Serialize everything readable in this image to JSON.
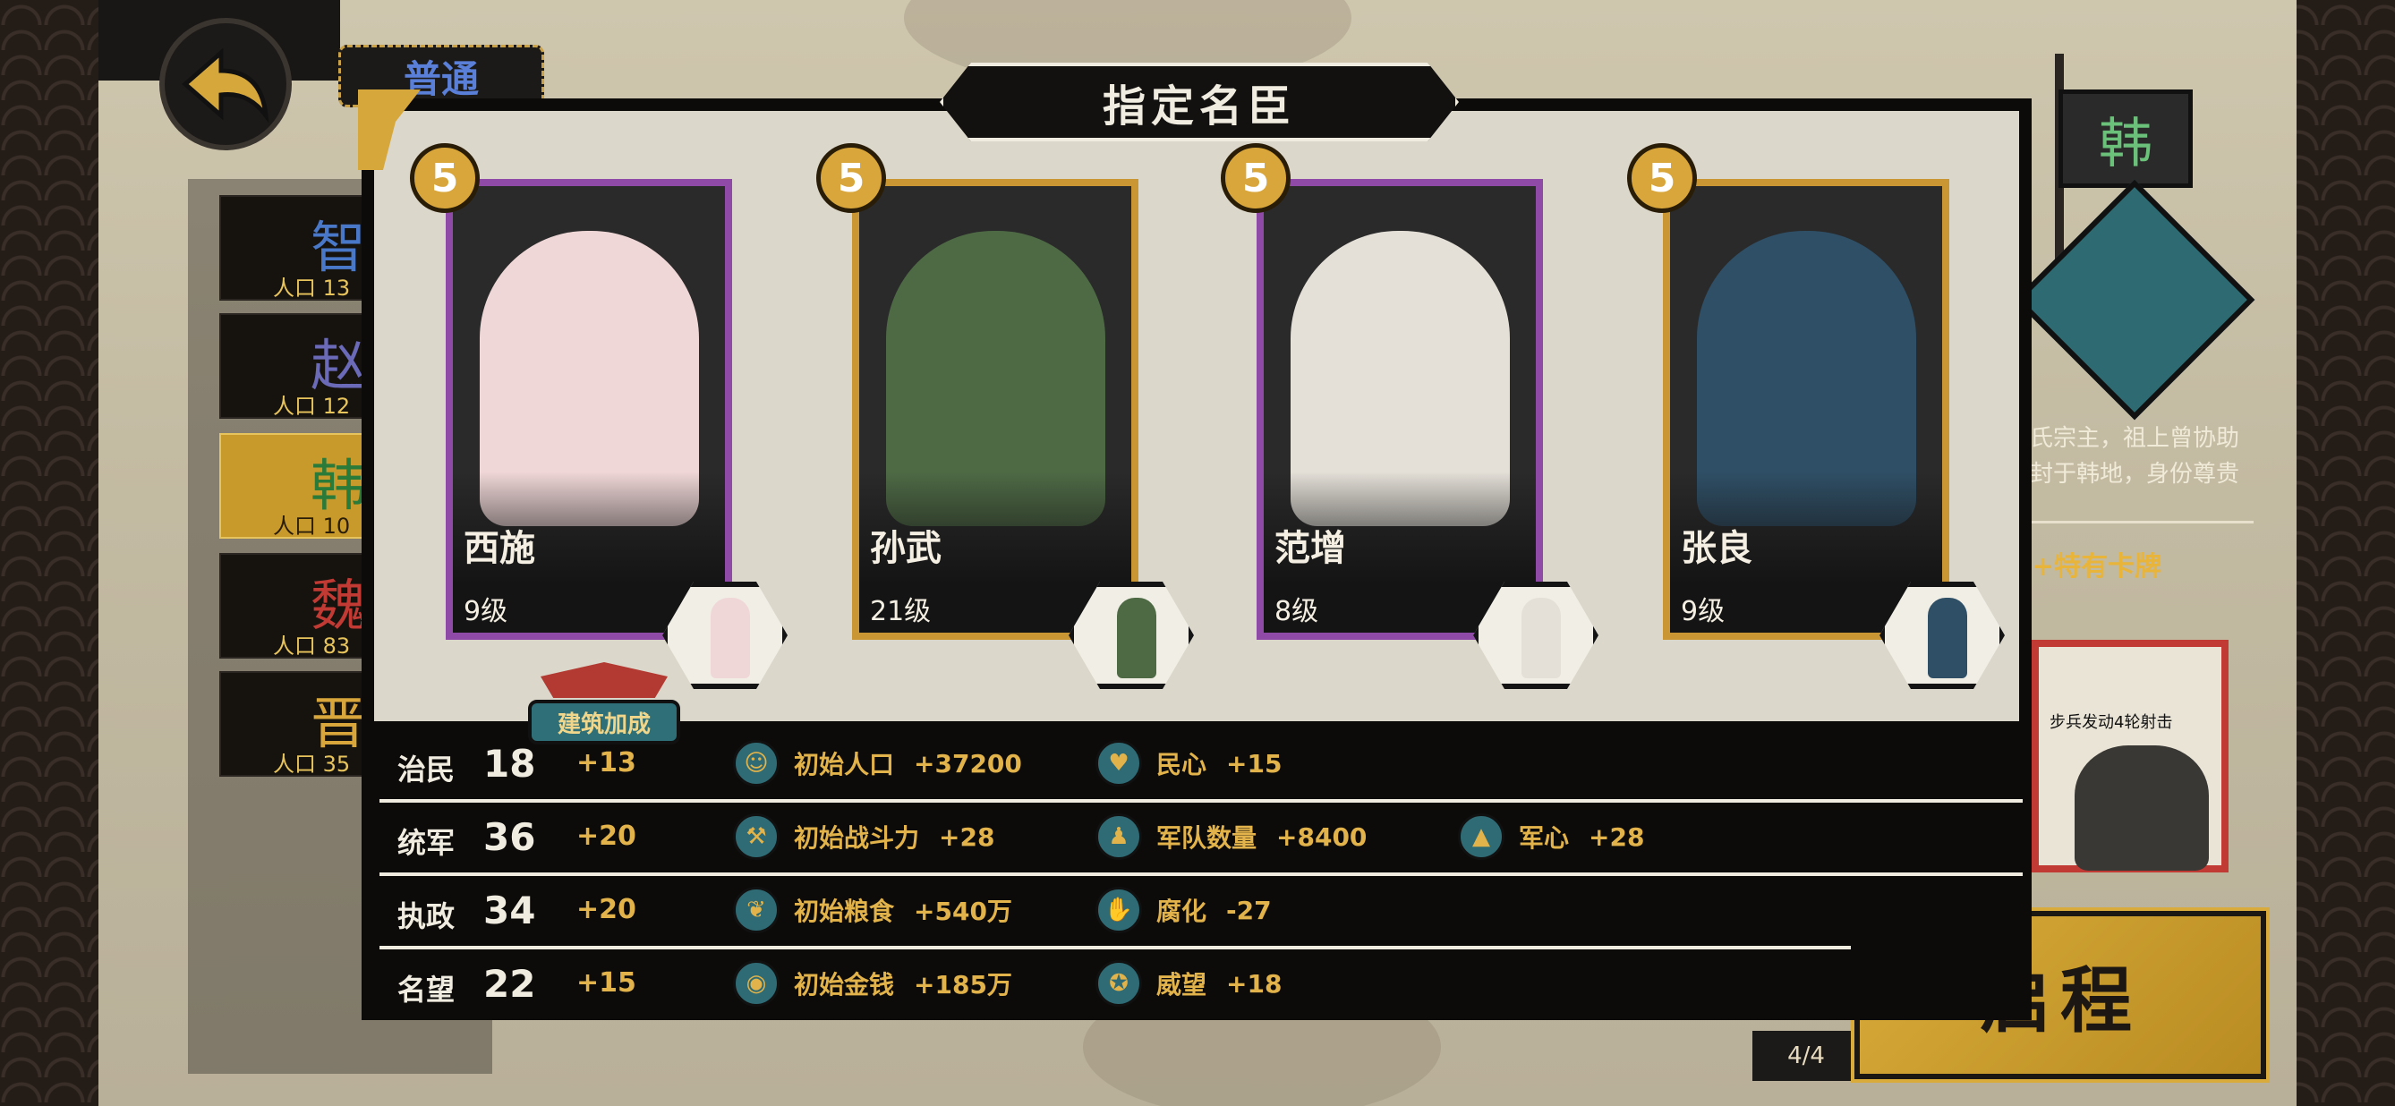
{
  "top": {
    "mode_label": "普通"
  },
  "factions": [
    {
      "name": "智",
      "population": "人口 13",
      "color": "#4a78c8"
    },
    {
      "name": "赵",
      "population": "人口 12",
      "color": "#6a6ab8"
    },
    {
      "name": "韩",
      "population": "人口 10",
      "color": "#2a7a3a"
    },
    {
      "name": "魏",
      "population": "人口 83",
      "color": "#c23a34"
    },
    {
      "name": "晋",
      "population": "人口 35",
      "color": "#d8a63a"
    }
  ],
  "dialog": {
    "title": "指定名臣"
  },
  "heroes": [
    {
      "name": "西施",
      "level": "9级",
      "rank": "5",
      "frame": "purple",
      "robe": "#f0d7d7"
    },
    {
      "name": "孙武",
      "level": "21级",
      "rank": "5",
      "frame": "gold",
      "robe": "#4e6a45"
    },
    {
      "name": "范增",
      "level": "8级",
      "rank": "5",
      "frame": "purple",
      "robe": "#e4e0d8"
    },
    {
      "name": "张良",
      "level": "9级",
      "rank": "5",
      "frame": "gold",
      "robe": "#2f4f66"
    }
  ],
  "building_bonus_label": "建筑加成",
  "stats": [
    {
      "name": "治民",
      "value": "18",
      "bonus": "+13",
      "effects": [
        {
          "icon": "population-icon",
          "label": "初始人口",
          "value": "+37200"
        },
        {
          "icon": "heart-icon",
          "label": "民心",
          "value": "+15"
        }
      ]
    },
    {
      "name": "统军",
      "value": "36",
      "bonus": "+20",
      "effects": [
        {
          "icon": "weapon-icon",
          "label": "初始战斗力",
          "value": "+28"
        },
        {
          "icon": "troops-icon",
          "label": "军队数量",
          "value": "+8400"
        },
        {
          "icon": "helmet-icon",
          "label": "军心",
          "value": "+28"
        }
      ]
    },
    {
      "name": "执政",
      "value": "34",
      "bonus": "+20",
      "effects": [
        {
          "icon": "grain-icon",
          "label": "初始粮食",
          "value": "+540万"
        },
        {
          "icon": "corruption-icon",
          "label": "腐化",
          "value": "-27"
        }
      ]
    },
    {
      "name": "名望",
      "value": "22",
      "bonus": "+15",
      "effects": [
        {
          "icon": "coin-icon",
          "label": "初始金钱",
          "value": "+185万"
        },
        {
          "icon": "prestige-icon",
          "label": "威望",
          "value": "+18"
        }
      ]
    }
  ],
  "right_panel": {
    "banner": "韩",
    "description": "氏宗主，祖上曾协助\n封于韩地，身份尊贵",
    "card_label": "+特有卡牌",
    "card_caption": "步兵发动4轮射击"
  },
  "page_counter": "4/4",
  "start_button": "启程"
}
